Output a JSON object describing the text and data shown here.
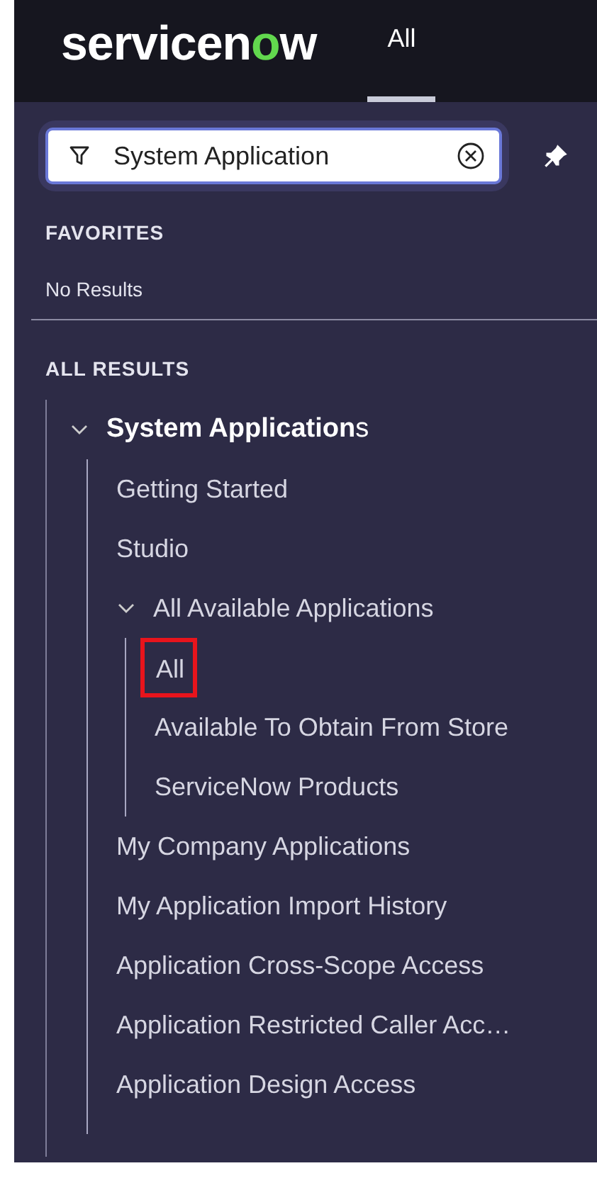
{
  "header": {
    "logo": [
      {
        "text": "servicen",
        "accent": false
      },
      {
        "text": "o",
        "accent": true
      },
      {
        "text": "w",
        "accent": false
      }
    ],
    "tabs": [
      {
        "label": "All",
        "selected": true
      }
    ]
  },
  "filter": {
    "value": "System Application"
  },
  "favorites": {
    "heading": "FAVORITES",
    "empty_text": "No Results"
  },
  "results": {
    "heading": "ALL RESULTS",
    "tree": [
      {
        "label": "**System Application**s",
        "expanded": true,
        "children": [
          {
            "label": "Getting Started",
            "highlighted": false
          },
          {
            "label": "Studio",
            "highlighted": false
          },
          {
            "label": "All Available Applications",
            "expanded": true,
            "children": [
              {
                "label": "All",
                "highlighted": true
              },
              {
                "label": "Available To Obtain From Store",
                "highlighted": false
              },
              {
                "label": "ServiceNow Products",
                "highlighted": false
              }
            ]
          },
          {
            "label": "My Company Applications",
            "highlighted": false
          },
          {
            "label": "My Application Import History",
            "highlighted": false
          },
          {
            "label": "Application Cross-Scope Access",
            "highlighted": false
          },
          {
            "label": "Application Restricted Caller Acc…",
            "highlighted": false
          },
          {
            "label": "Application Design Access",
            "highlighted": false
          }
        ]
      }
    ]
  }
}
